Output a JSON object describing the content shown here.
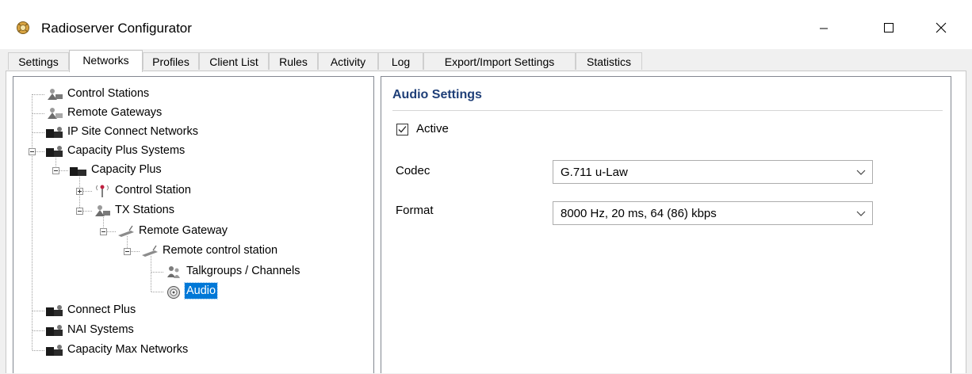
{
  "window": {
    "title": "Radioserver Configurator",
    "controls": {
      "minimize": "minimize-icon",
      "maximize": "maximize-icon",
      "close": "close-icon"
    }
  },
  "tabs": [
    {
      "label": "Settings"
    },
    {
      "label": "Networks",
      "active": true
    },
    {
      "label": "Profiles"
    },
    {
      "label": "Client List"
    },
    {
      "label": "Rules"
    },
    {
      "label": "Activity"
    },
    {
      "label": "Log"
    },
    {
      "label": "Export/Import Settings"
    },
    {
      "label": "Statistics"
    }
  ],
  "tree": {
    "nodes": [
      {
        "label": "Control Stations",
        "icon": "control-station-icon"
      },
      {
        "label": "Remote Gateways",
        "icon": "gateway-icon"
      },
      {
        "label": "IP Site Connect Networks",
        "icon": "network-icon"
      },
      {
        "label": "Capacity Plus Systems",
        "icon": "network-icon",
        "expanded": true
      },
      {
        "label": "Capacity Plus",
        "icon": "network-icon",
        "expanded": true
      },
      {
        "label": "Control Station",
        "icon": "antenna-icon",
        "expanded": false
      },
      {
        "label": "TX Stations",
        "icon": "control-station-icon",
        "expanded": true
      },
      {
        "label": "Remote Gateway",
        "icon": "radio-icon",
        "expanded": true
      },
      {
        "label": "Remote control station",
        "icon": "radio-icon",
        "expanded": true
      },
      {
        "label": "Talkgroups / Channels",
        "icon": "talkgroup-icon"
      },
      {
        "label": "Audio",
        "icon": "speaker-icon",
        "selected": true
      },
      {
        "label": "Connect Plus",
        "icon": "network-icon"
      },
      {
        "label": "NAI Systems",
        "icon": "network-icon"
      },
      {
        "label": "Capacity Max Networks",
        "icon": "network-icon"
      }
    ]
  },
  "audio_settings": {
    "title": "Audio Settings",
    "active_label": "Active",
    "active_checked": true,
    "codec_label": "Codec",
    "codec_value": "G.711 u-Law",
    "format_label": "Format",
    "format_value": "8000 Hz, 20 ms, 64 (86) kbps"
  },
  "colors": {
    "selection": "#0078d7",
    "section_title": "#1f3f78"
  }
}
